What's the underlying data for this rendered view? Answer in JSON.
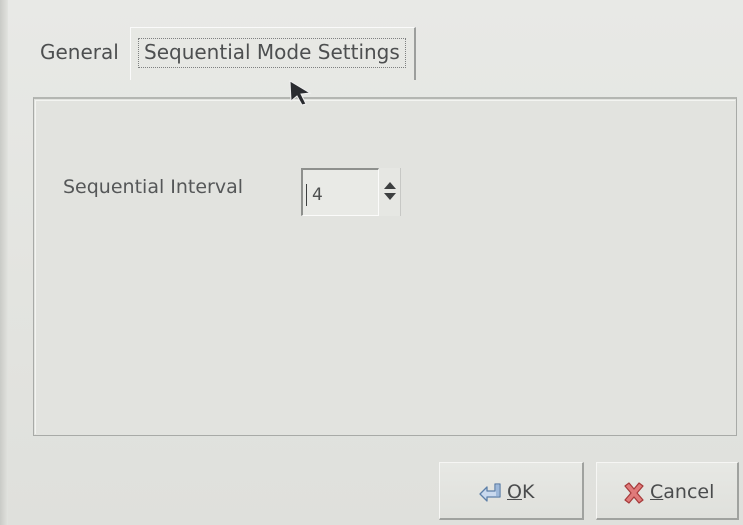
{
  "tabs": [
    {
      "label": "General",
      "selected": false
    },
    {
      "label": "Sequential Mode Settings",
      "selected": true
    }
  ],
  "settings": {
    "sequential_interval": {
      "label": "Sequential Interval",
      "value": "4"
    }
  },
  "buttons": {
    "ok": {
      "mnemonic": "O",
      "rest": "K",
      "icon": "ok-arrow-icon"
    },
    "cancel": {
      "mnemonic": "C",
      "rest": "ancel",
      "icon": "cancel-x-icon"
    }
  },
  "colors": {
    "background": "#e4e5e1",
    "text": "#4d4f50",
    "cancel_icon": "#d05a5a",
    "ok_icon": "#7a9fc9"
  }
}
